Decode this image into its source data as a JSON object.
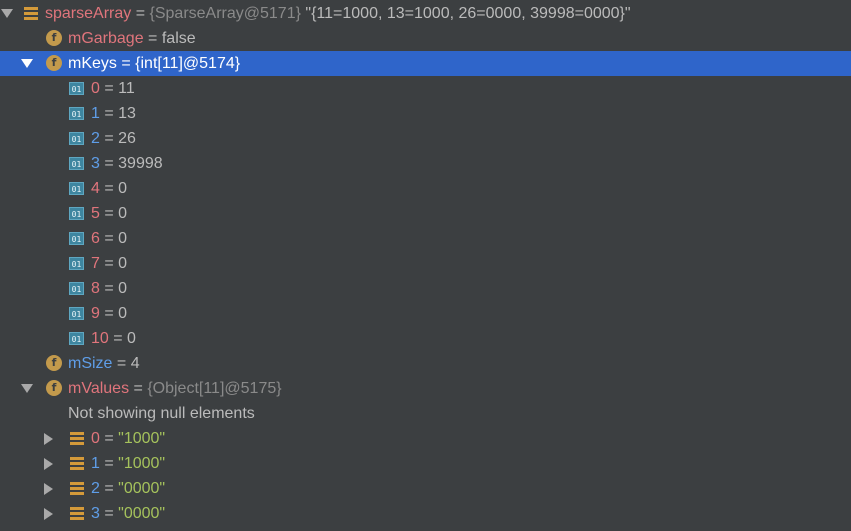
{
  "tree": {
    "root": {
      "name": "sparseArray",
      "ref": "{SparseArray@5171}",
      "value": "\"{11=1000, 13=1000, 26=0000, 39998=0000}\""
    },
    "mGarbage": {
      "name": "mGarbage",
      "value": "false"
    },
    "mKeys": {
      "name": "mKeys",
      "ref": "{int[11]@5174}",
      "items": [
        {
          "index": "0",
          "value": "11"
        },
        {
          "index": "1",
          "value": "13"
        },
        {
          "index": "2",
          "value": "26"
        },
        {
          "index": "3",
          "value": "39998"
        },
        {
          "index": "4",
          "value": "0"
        },
        {
          "index": "5",
          "value": "0"
        },
        {
          "index": "6",
          "value": "0"
        },
        {
          "index": "7",
          "value": "0"
        },
        {
          "index": "8",
          "value": "0"
        },
        {
          "index": "9",
          "value": "0"
        },
        {
          "index": "10",
          "value": "0"
        }
      ]
    },
    "mSize": {
      "name": "mSize",
      "value": "4"
    },
    "mValues": {
      "name": "mValues",
      "ref": "{Object[11]@5175}",
      "note": "Not showing null elements",
      "items": [
        {
          "index": "0",
          "value": "\"1000\""
        },
        {
          "index": "1",
          "value": "\"1000\""
        },
        {
          "index": "2",
          "value": "\"0000\""
        },
        {
          "index": "3",
          "value": "\"0000\""
        }
      ]
    },
    "eq": "=",
    "icon_label_f": "f",
    "icon_label_01": "01"
  },
  "colors": {
    "background": "#3c3f41",
    "selection": "#2f65ca",
    "field_name": "#e0757c",
    "index_blue": "#5f9ee8",
    "string_value": "#a5c25c",
    "reference": "#8a8a8a"
  }
}
